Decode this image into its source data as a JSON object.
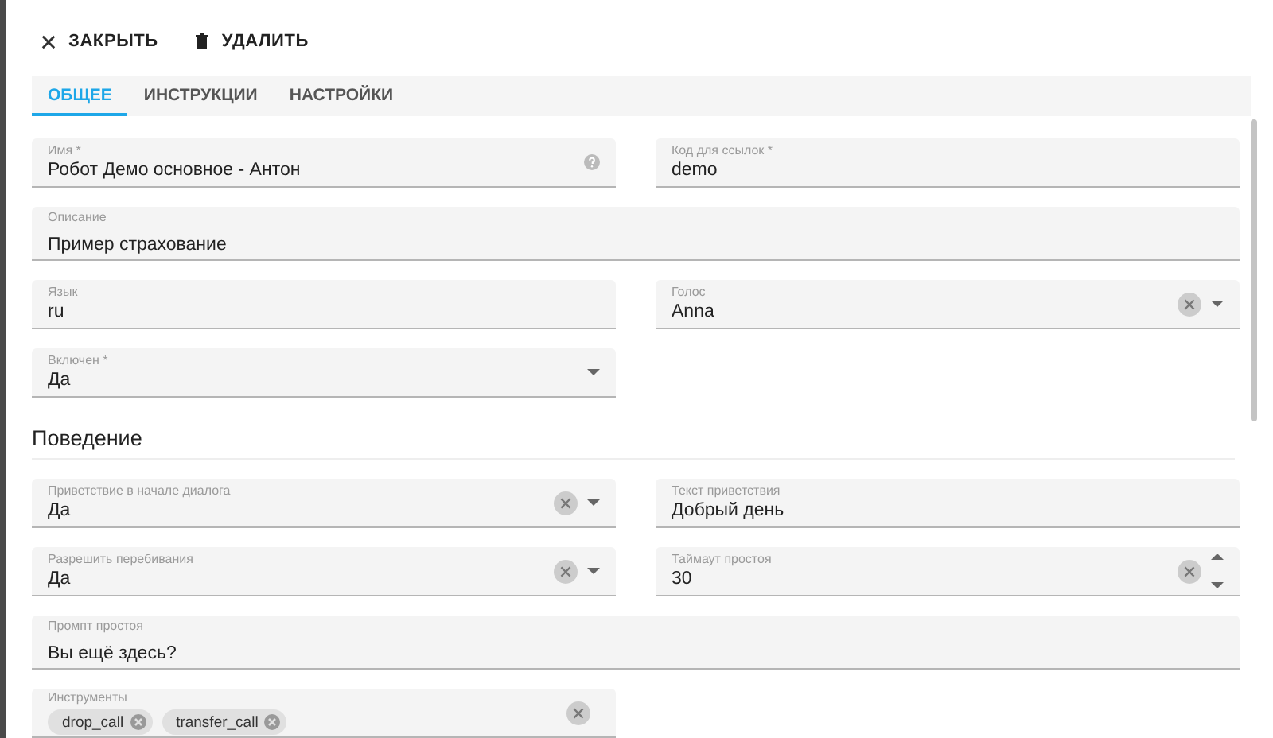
{
  "toolbar": [
    {
      "label": "ЗАКРЫТЬ"
    },
    {
      "label": "УДАЛИТЬ"
    }
  ],
  "tabs": [
    {
      "label": "ОБЩЕЕ",
      "selected": true
    },
    {
      "label": "ИНСТРУКЦИИ",
      "selected": false
    },
    {
      "label": "НАСТРОЙКИ",
      "selected": false
    }
  ],
  "groups": [
    {
      "fields": [
        {
          "kind": "text",
          "label": "Имя *",
          "value": "Робот Демо основное - Антон",
          "help": true
        },
        {
          "kind": "text",
          "label": "Код для ссылок *",
          "value": "demo"
        },
        {
          "kind": "multiline",
          "label": "Описание",
          "value": "Пример страхование"
        },
        {
          "kind": "text",
          "label": "Язык",
          "value": "ru"
        },
        {
          "kind": "select",
          "label": "Голос",
          "value": "Anna",
          "clearable": true
        },
        {
          "kind": "select",
          "label": "Включен *",
          "value": "Да"
        }
      ]
    },
    {
      "title": "Поведение",
      "fields": [
        {
          "kind": "select",
          "label": "Приветствие в начале диалога",
          "value": "Да",
          "clearable": true
        },
        {
          "kind": "text",
          "label": "Текст приветствия",
          "value": "Добрый день"
        },
        {
          "kind": "select",
          "label": "Разрешить перебивания",
          "value": "Да",
          "clearable": true
        },
        {
          "kind": "number",
          "label": "Таймаут простоя",
          "value": "30",
          "clearable": true
        },
        {
          "kind": "multiline",
          "label": "Промпт простоя",
          "value": "Вы ещё здесь?"
        },
        {
          "kind": "chips",
          "label": "Инструменты",
          "chips": [
            "drop_call",
            "transfer_call"
          ],
          "clearable": true
        }
      ]
    }
  ]
}
